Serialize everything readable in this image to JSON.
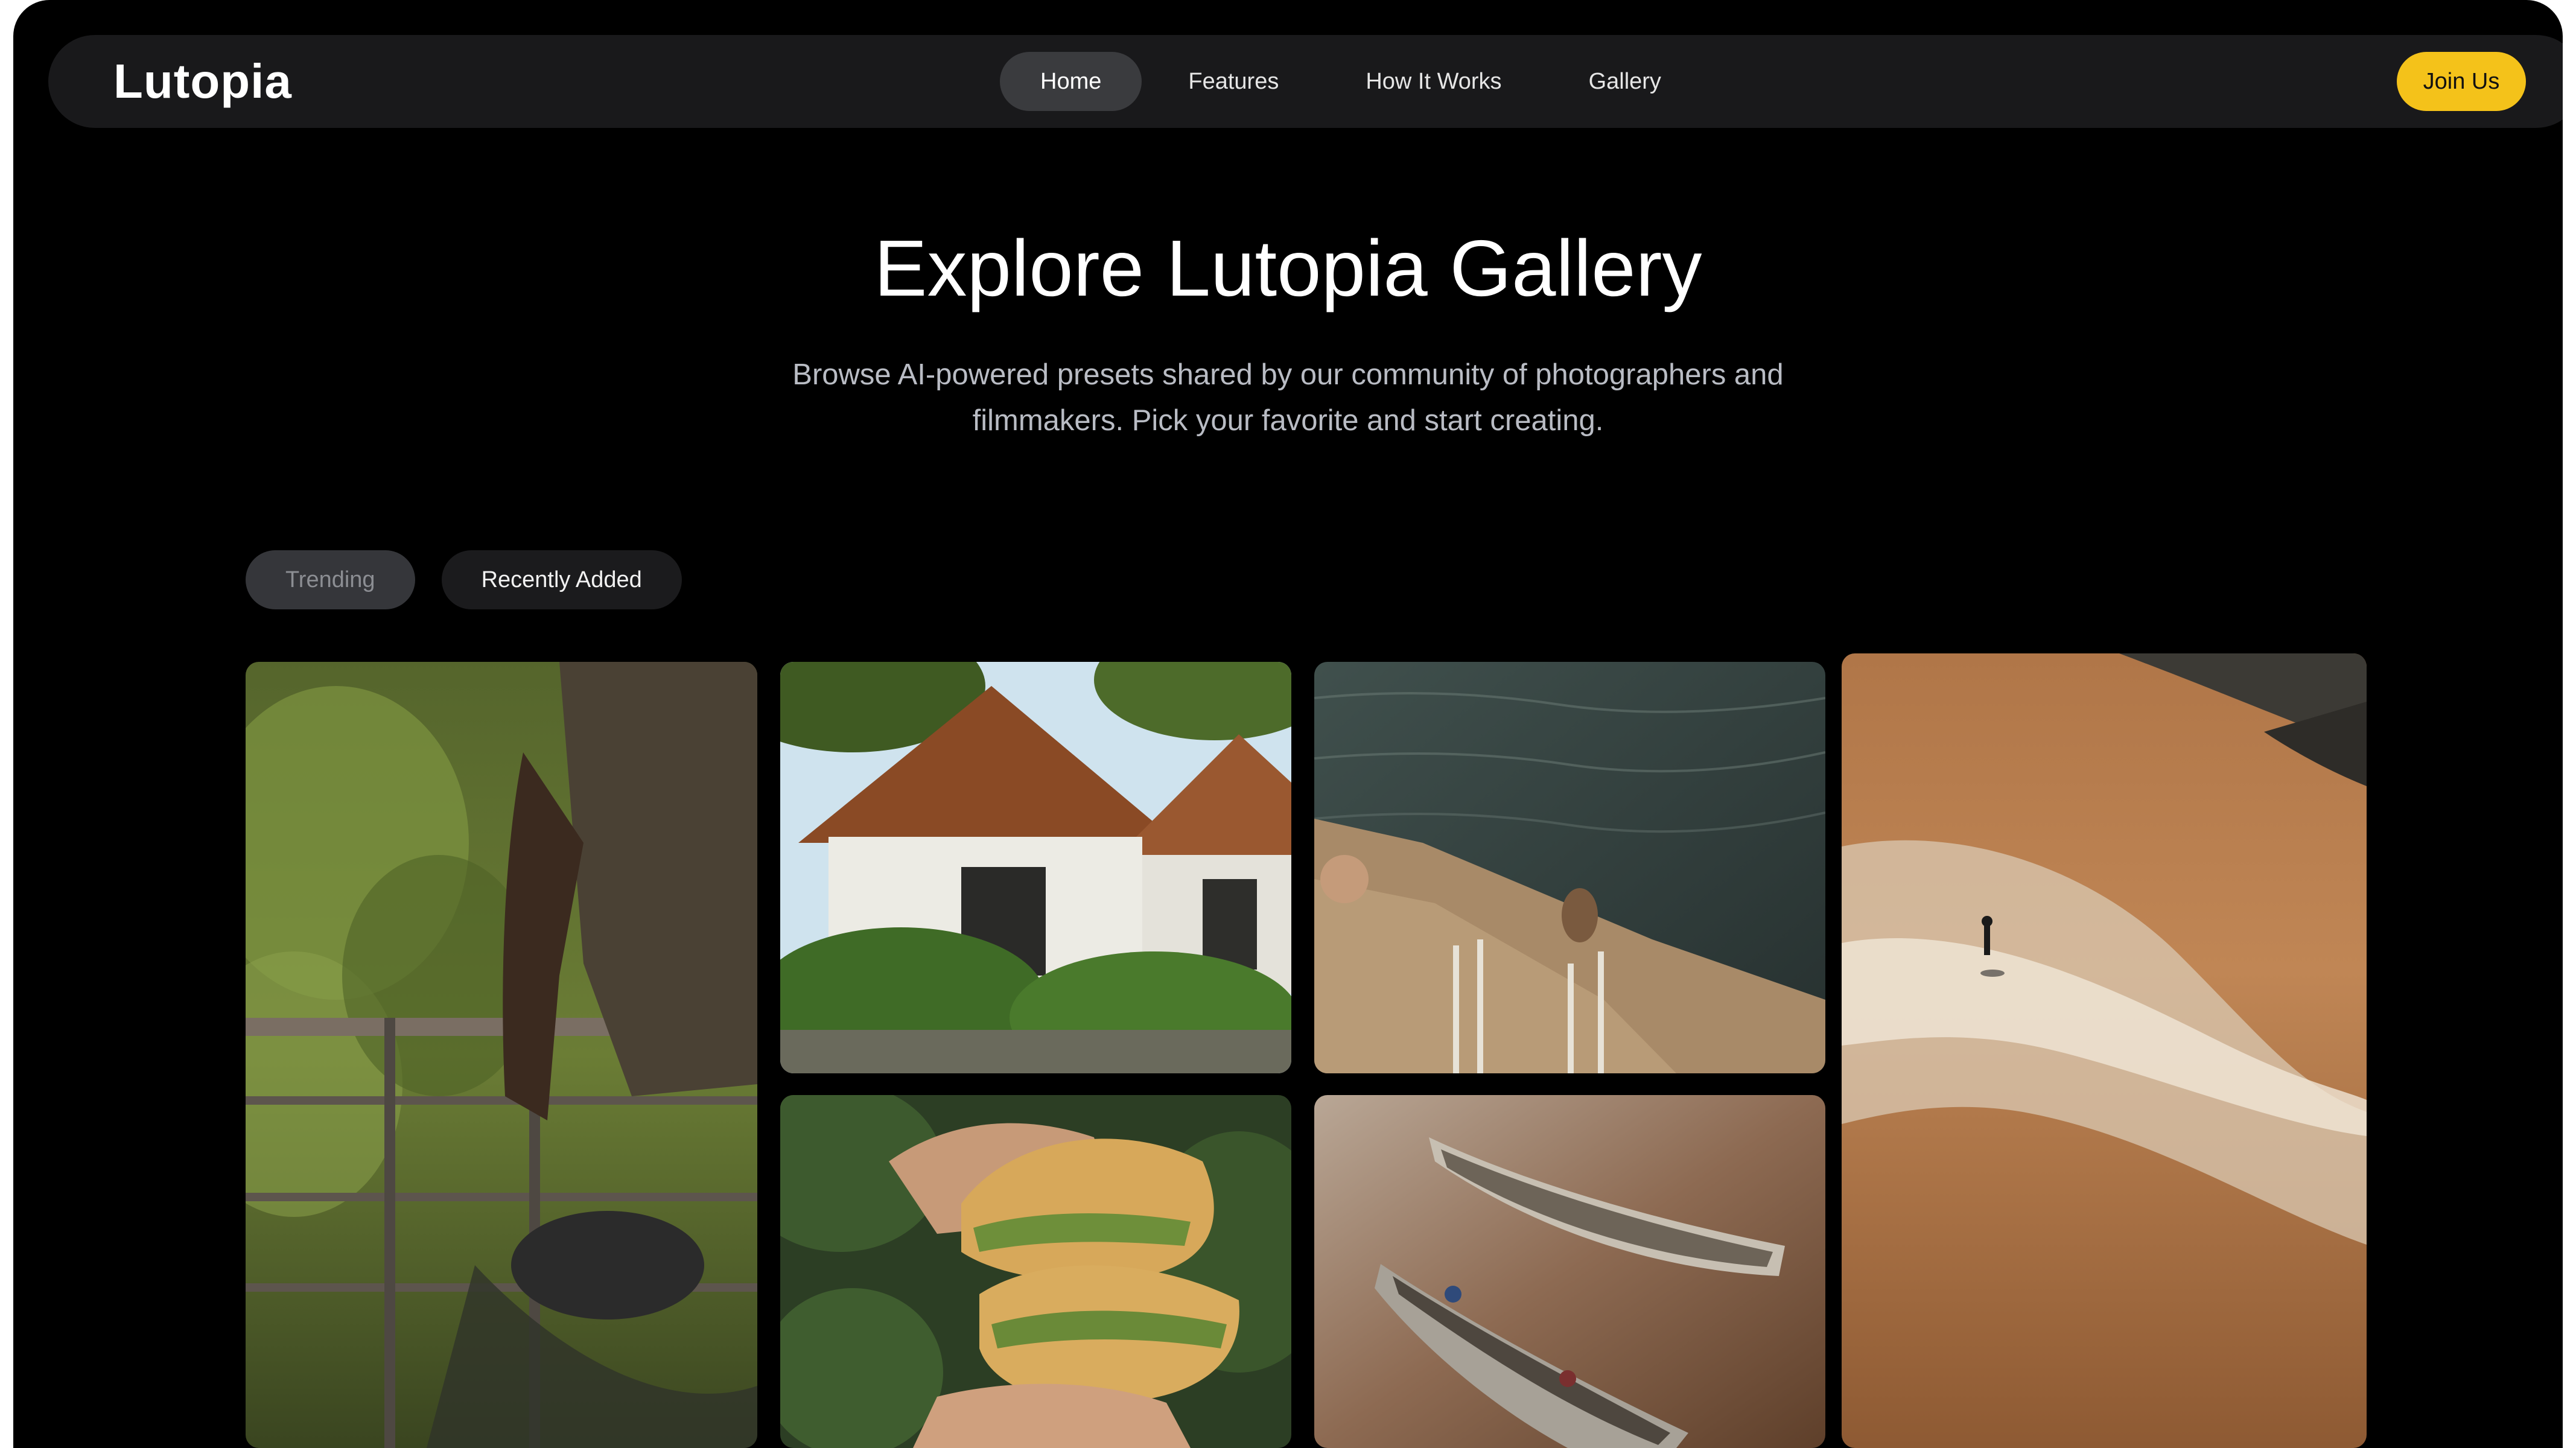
{
  "app": {
    "logo": "Lutopia"
  },
  "nav": {
    "items": [
      {
        "label": "Home",
        "active": true
      },
      {
        "label": "Features",
        "active": false
      },
      {
        "label": "How It Works",
        "active": false
      },
      {
        "label": "Gallery",
        "active": false
      }
    ],
    "join_label": "Join Us"
  },
  "hero": {
    "title": "Explore Lutopia Gallery",
    "subtitle": "Browse AI-powered presets shared by our community of photographers and filmmakers. Pick your favorite and start creating."
  },
  "filters": [
    {
      "label": "Trending",
      "selected": true
    },
    {
      "label": "Recently Added",
      "selected": false
    }
  ],
  "gallery": [
    {
      "subject": "man on bicycle by railing in greenery"
    },
    {
      "subject": "tropical bungalow with plants"
    },
    {
      "subject": "people sitting on pier by water"
    },
    {
      "subject": "person walking on sandy beach"
    },
    {
      "subject": "hands holding sandwich"
    },
    {
      "subject": "wooden boats on brown water"
    }
  ],
  "colors": {
    "background": "#000000",
    "navbar": "#19191b",
    "accent": "#f4c21a",
    "pill_active": "#35363a",
    "pill_inactive": "#1b1b1d"
  }
}
